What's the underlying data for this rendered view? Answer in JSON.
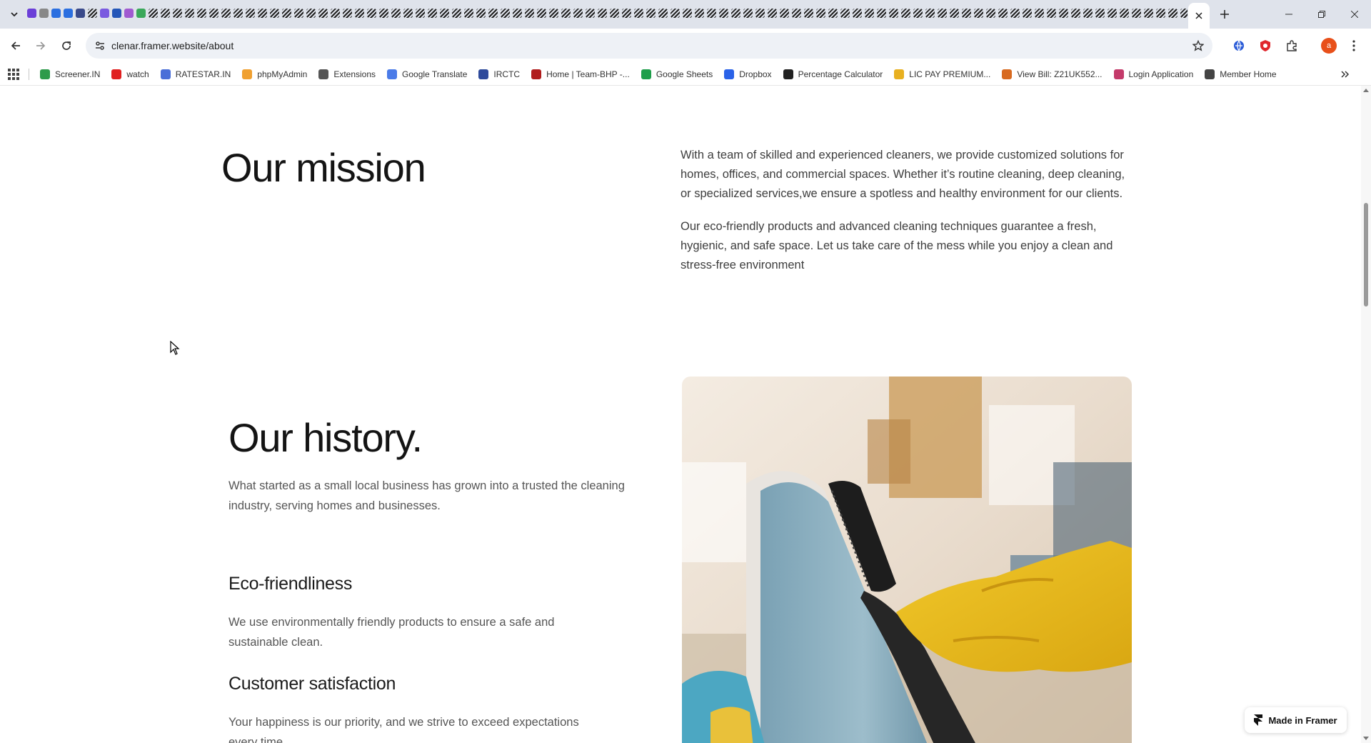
{
  "browser": {
    "url": "clenar.framer.website/about",
    "profile_initial": "a",
    "bookmarks": [
      {
        "label": "Screener.IN",
        "color": "#2e9b4a"
      },
      {
        "label": "watch",
        "color": "#e02020"
      },
      {
        "label": "RATESTAR.IN",
        "color": "#4a6fd8"
      },
      {
        "label": "phpMyAdmin",
        "color": "#f0a030"
      },
      {
        "label": "Extensions",
        "color": "#555555"
      },
      {
        "label": "Google Translate",
        "color": "#4a7be8"
      },
      {
        "label": "IRCTC",
        "color": "#2e4a9b"
      },
      {
        "label": "Home | Team-BHP -...",
        "color": "#b01c1c"
      },
      {
        "label": "Google Sheets",
        "color": "#1e9e4a"
      },
      {
        "label": "Dropbox",
        "color": "#2a62e8"
      },
      {
        "label": "Percentage Calculator",
        "color": "#222222"
      },
      {
        "label": "LIC PAY PREMIUM...",
        "color": "#e8b020"
      },
      {
        "label": "View Bill: Z21UK552...",
        "color": "#d86a20"
      },
      {
        "label": "Login Application",
        "color": "#c43a6a"
      },
      {
        "label": "Member Home",
        "color": "#444444"
      }
    ]
  },
  "page": {
    "mission": {
      "title": "Our mission",
      "para1": "With a team of skilled and experienced cleaners, we provide customized solutions for homes, offices, and commercial spaces. Whether it’s routine cleaning, deep cleaning, or specialized services,we ensure a spotless and healthy environment for our clients.",
      "para2": "Our eco-friendly products and advanced cleaning techniques guarantee a fresh, hygienic, and safe space. Let us take care of the mess while you enjoy a clean and stress-free environment"
    },
    "history": {
      "title": "Our history.",
      "text": "What started as a small local business has grown into a trusted the cleaning industry, serving homes and businesses."
    },
    "eco": {
      "title": "Eco-friendliness",
      "text": "We use environmentally friendly products to ensure a safe and sustainable clean."
    },
    "satisfaction": {
      "title": "Customer satisfaction",
      "text": "Your happiness is our priority, and we strive to exceed expectations every time."
    },
    "badge": "Made in Framer"
  }
}
